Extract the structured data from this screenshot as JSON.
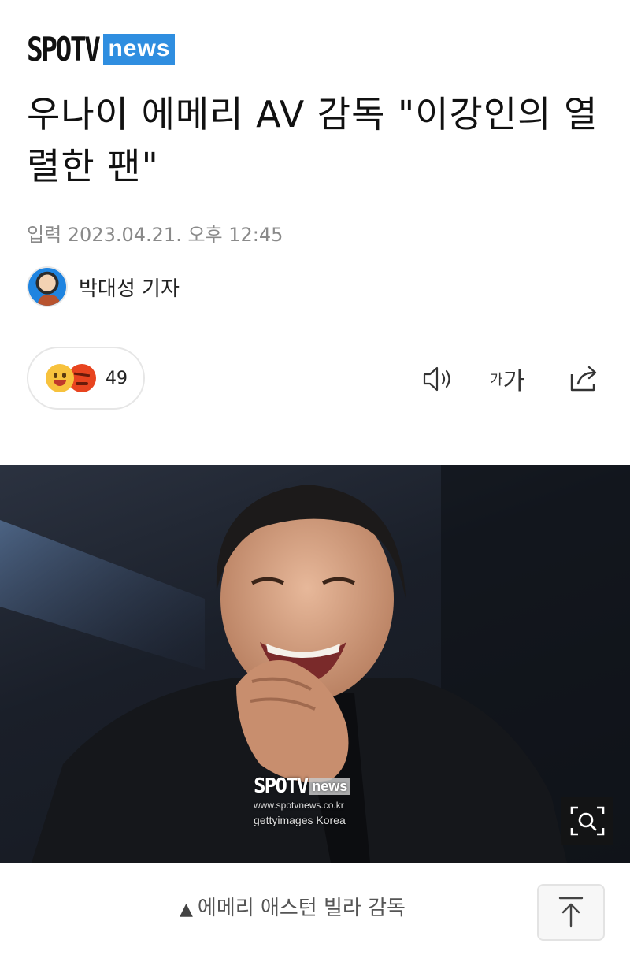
{
  "header": {
    "logo_spotv": "SPOTV",
    "logo_news": "news"
  },
  "article": {
    "title": "우나이 에메리 AV 감독 \"이강인의 열렬한 팬\"",
    "date": "입력 2023.04.21. 오후 12:45",
    "author": "박대성 기자"
  },
  "reactions": {
    "count": "49",
    "icons": [
      "smile-emoji",
      "angry-emoji"
    ]
  },
  "tools": {
    "font_small": "가",
    "font_big": "가",
    "audio_icon": "speaker-icon",
    "share_icon": "share-icon"
  },
  "photo": {
    "watermark_spotv": "SPOTV",
    "watermark_news": "news",
    "watermark_url": "www.spotvnews.co.kr",
    "watermark_getty": "gettyimages Korea",
    "zoom_icon": "zoom-icon"
  },
  "caption": {
    "marker": "▲",
    "text": "에메리 애스턴 빌라 감독"
  },
  "scroll_top_icon": "arrow-up-icon",
  "colors": {
    "brand_blue": "#2f8ee0",
    "text_dark": "#111111",
    "text_muted": "#8a8a8a"
  }
}
